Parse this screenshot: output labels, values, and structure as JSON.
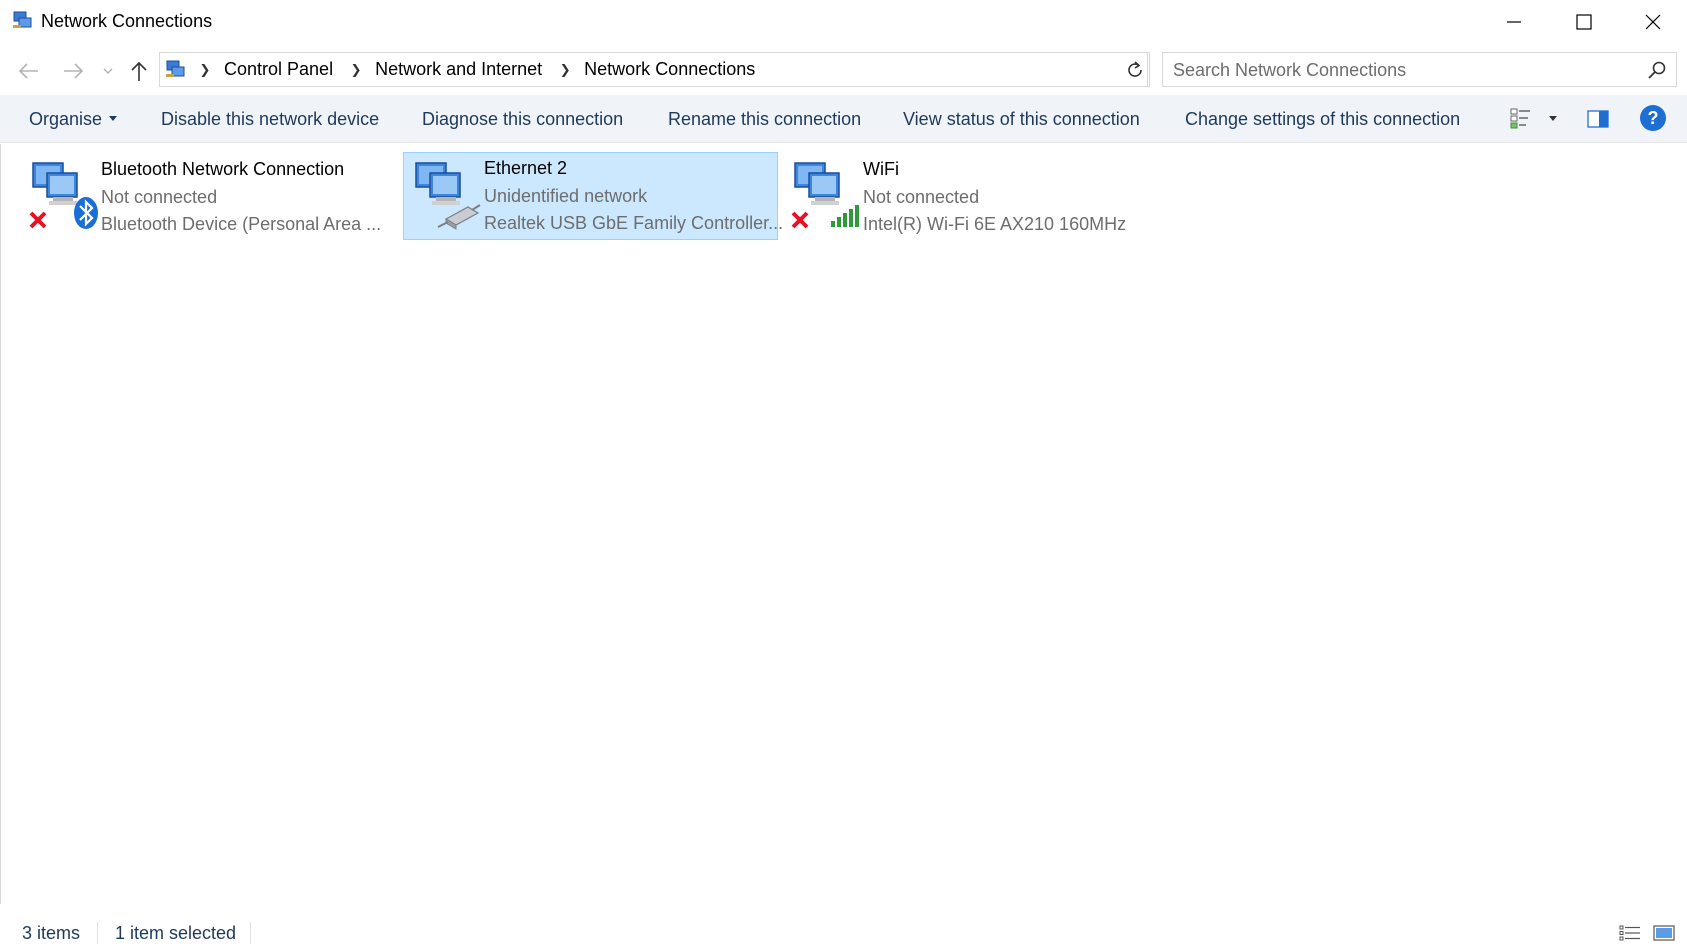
{
  "window": {
    "title": "Network Connections",
    "controls": {
      "minimize": "minimize",
      "maximize": "maximize",
      "close": "close"
    }
  },
  "address": {
    "breadcrumbs": [
      "Control Panel",
      "Network and Internet",
      "Network Connections"
    ],
    "search_placeholder": "Search Network Connections"
  },
  "toolbar": {
    "organise": "Organise",
    "disable": "Disable this network device",
    "diagnose": "Diagnose this connection",
    "rename": "Rename this connection",
    "view_status": "View status of this connection",
    "change_settings": "Change settings of this connection",
    "help": "?"
  },
  "connections": [
    {
      "name": "Bluetooth Network Connection",
      "status": "Not connected",
      "device": "Bluetooth Device (Personal Area ...",
      "icon": "bluetooth-network-icon",
      "selected": false
    },
    {
      "name": "Ethernet 2",
      "status": "Unidentified network",
      "device": "Realtek USB GbE Family Controller...",
      "icon": "ethernet-network-icon",
      "selected": true
    },
    {
      "name": "WiFi",
      "status": "Not connected",
      "device": "Intel(R) Wi-Fi 6E AX210 160MHz",
      "icon": "wifi-network-icon",
      "selected": false
    }
  ],
  "statusbar": {
    "count": "3 items",
    "selected": "1 item selected"
  },
  "colors": {
    "selection_bg": "#cce8ff",
    "selection_border": "#99d1ff",
    "toolbar_bg": "#f0f4f9",
    "toolbar_text": "#1e395b",
    "help_blue": "#1f6fd2",
    "error_red": "#e81123",
    "signal_green": "#2e9a3a",
    "bluetooth_blue": "#1a6fd6"
  }
}
